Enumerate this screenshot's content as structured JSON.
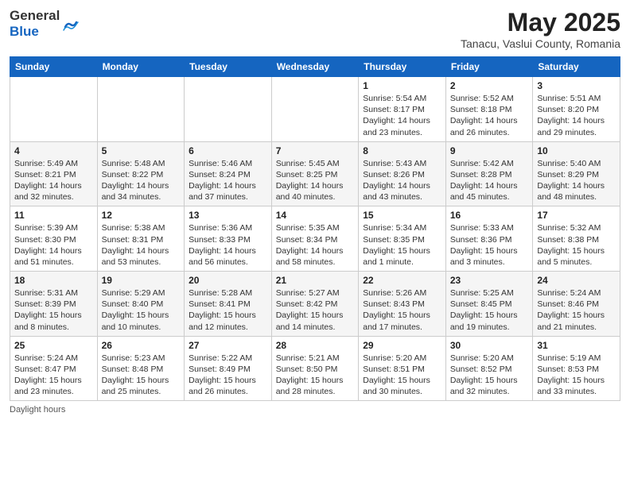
{
  "header": {
    "logo_general": "General",
    "logo_blue": "Blue",
    "month_title": "May 2025",
    "location": "Tanacu, Vaslui County, Romania"
  },
  "days_of_week": [
    "Sunday",
    "Monday",
    "Tuesday",
    "Wednesday",
    "Thursday",
    "Friday",
    "Saturday"
  ],
  "weeks": [
    [
      {
        "day": "",
        "info": ""
      },
      {
        "day": "",
        "info": ""
      },
      {
        "day": "",
        "info": ""
      },
      {
        "day": "",
        "info": ""
      },
      {
        "day": "1",
        "info": "Sunrise: 5:54 AM\nSunset: 8:17 PM\nDaylight: 14 hours\nand 23 minutes."
      },
      {
        "day": "2",
        "info": "Sunrise: 5:52 AM\nSunset: 8:18 PM\nDaylight: 14 hours\nand 26 minutes."
      },
      {
        "day": "3",
        "info": "Sunrise: 5:51 AM\nSunset: 8:20 PM\nDaylight: 14 hours\nand 29 minutes."
      }
    ],
    [
      {
        "day": "4",
        "info": "Sunrise: 5:49 AM\nSunset: 8:21 PM\nDaylight: 14 hours\nand 32 minutes."
      },
      {
        "day": "5",
        "info": "Sunrise: 5:48 AM\nSunset: 8:22 PM\nDaylight: 14 hours\nand 34 minutes."
      },
      {
        "day": "6",
        "info": "Sunrise: 5:46 AM\nSunset: 8:24 PM\nDaylight: 14 hours\nand 37 minutes."
      },
      {
        "day": "7",
        "info": "Sunrise: 5:45 AM\nSunset: 8:25 PM\nDaylight: 14 hours\nand 40 minutes."
      },
      {
        "day": "8",
        "info": "Sunrise: 5:43 AM\nSunset: 8:26 PM\nDaylight: 14 hours\nand 43 minutes."
      },
      {
        "day": "9",
        "info": "Sunrise: 5:42 AM\nSunset: 8:28 PM\nDaylight: 14 hours\nand 45 minutes."
      },
      {
        "day": "10",
        "info": "Sunrise: 5:40 AM\nSunset: 8:29 PM\nDaylight: 14 hours\nand 48 minutes."
      }
    ],
    [
      {
        "day": "11",
        "info": "Sunrise: 5:39 AM\nSunset: 8:30 PM\nDaylight: 14 hours\nand 51 minutes."
      },
      {
        "day": "12",
        "info": "Sunrise: 5:38 AM\nSunset: 8:31 PM\nDaylight: 14 hours\nand 53 minutes."
      },
      {
        "day": "13",
        "info": "Sunrise: 5:36 AM\nSunset: 8:33 PM\nDaylight: 14 hours\nand 56 minutes."
      },
      {
        "day": "14",
        "info": "Sunrise: 5:35 AM\nSunset: 8:34 PM\nDaylight: 14 hours\nand 58 minutes."
      },
      {
        "day": "15",
        "info": "Sunrise: 5:34 AM\nSunset: 8:35 PM\nDaylight: 15 hours\nand 1 minute."
      },
      {
        "day": "16",
        "info": "Sunrise: 5:33 AM\nSunset: 8:36 PM\nDaylight: 15 hours\nand 3 minutes."
      },
      {
        "day": "17",
        "info": "Sunrise: 5:32 AM\nSunset: 8:38 PM\nDaylight: 15 hours\nand 5 minutes."
      }
    ],
    [
      {
        "day": "18",
        "info": "Sunrise: 5:31 AM\nSunset: 8:39 PM\nDaylight: 15 hours\nand 8 minutes."
      },
      {
        "day": "19",
        "info": "Sunrise: 5:29 AM\nSunset: 8:40 PM\nDaylight: 15 hours\nand 10 minutes."
      },
      {
        "day": "20",
        "info": "Sunrise: 5:28 AM\nSunset: 8:41 PM\nDaylight: 15 hours\nand 12 minutes."
      },
      {
        "day": "21",
        "info": "Sunrise: 5:27 AM\nSunset: 8:42 PM\nDaylight: 15 hours\nand 14 minutes."
      },
      {
        "day": "22",
        "info": "Sunrise: 5:26 AM\nSunset: 8:43 PM\nDaylight: 15 hours\nand 17 minutes."
      },
      {
        "day": "23",
        "info": "Sunrise: 5:25 AM\nSunset: 8:45 PM\nDaylight: 15 hours\nand 19 minutes."
      },
      {
        "day": "24",
        "info": "Sunrise: 5:24 AM\nSunset: 8:46 PM\nDaylight: 15 hours\nand 21 minutes."
      }
    ],
    [
      {
        "day": "25",
        "info": "Sunrise: 5:24 AM\nSunset: 8:47 PM\nDaylight: 15 hours\nand 23 minutes."
      },
      {
        "day": "26",
        "info": "Sunrise: 5:23 AM\nSunset: 8:48 PM\nDaylight: 15 hours\nand 25 minutes."
      },
      {
        "day": "27",
        "info": "Sunrise: 5:22 AM\nSunset: 8:49 PM\nDaylight: 15 hours\nand 26 minutes."
      },
      {
        "day": "28",
        "info": "Sunrise: 5:21 AM\nSunset: 8:50 PM\nDaylight: 15 hours\nand 28 minutes."
      },
      {
        "day": "29",
        "info": "Sunrise: 5:20 AM\nSunset: 8:51 PM\nDaylight: 15 hours\nand 30 minutes."
      },
      {
        "day": "30",
        "info": "Sunrise: 5:20 AM\nSunset: 8:52 PM\nDaylight: 15 hours\nand 32 minutes."
      },
      {
        "day": "31",
        "info": "Sunrise: 5:19 AM\nSunset: 8:53 PM\nDaylight: 15 hours\nand 33 minutes."
      }
    ]
  ],
  "footer": {
    "daylight_label": "Daylight hours"
  }
}
